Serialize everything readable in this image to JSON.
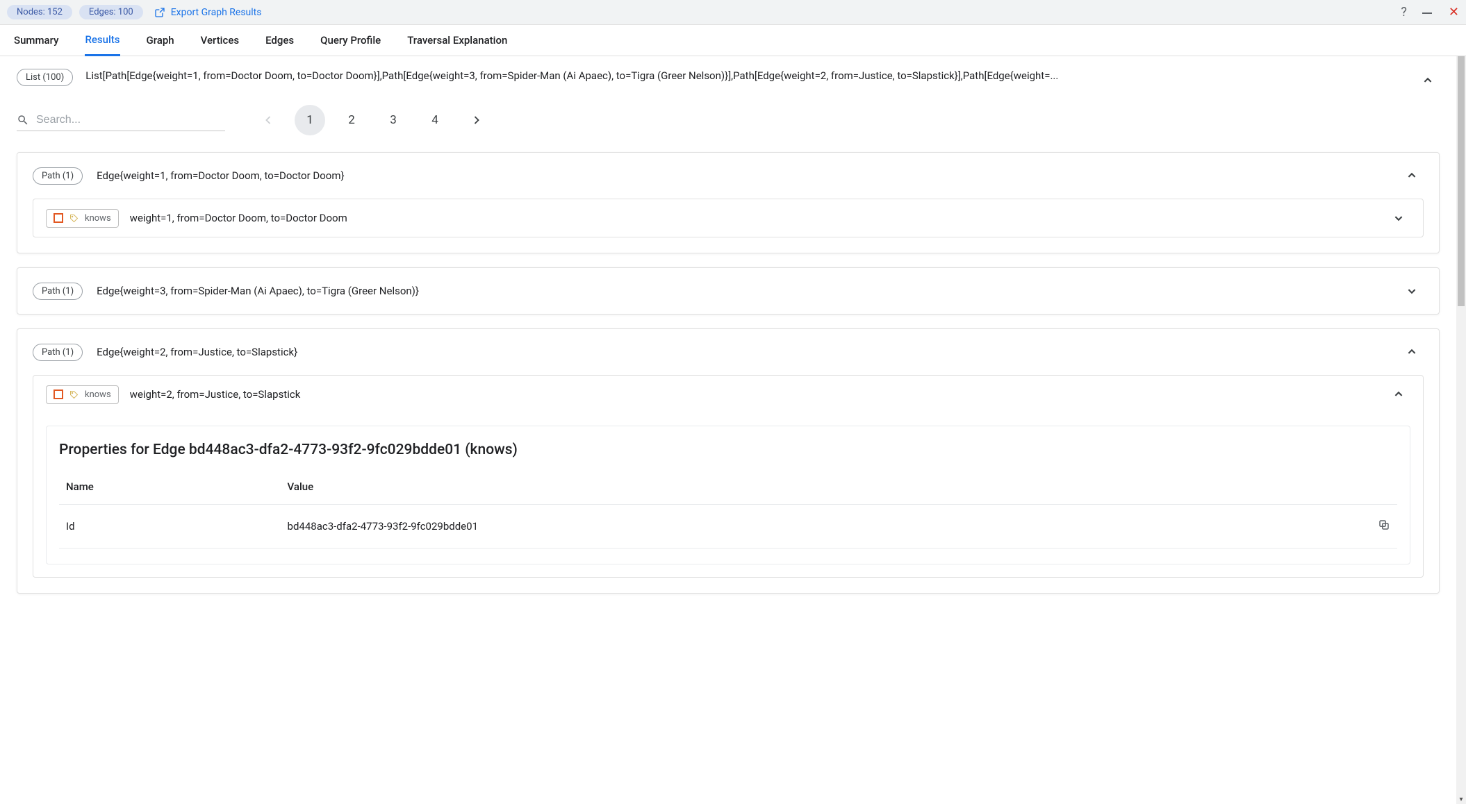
{
  "header": {
    "nodes_pill": "Nodes: 152",
    "edges_pill": "Edges: 100",
    "export_label": "Export Graph Results"
  },
  "tabs": {
    "summary": "Summary",
    "results": "Results",
    "graph": "Graph",
    "vertices": "Vertices",
    "edges": "Edges",
    "profile": "Query Profile",
    "traversal": "Traversal Explanation"
  },
  "list": {
    "chip": "List (100)",
    "text": "List[Path[Edge{weight=1, from=Doctor Doom, to=Doctor Doom}],Path[Edge{weight=3, from=Spider-Man (Ai Apaec), to=Tigra (Greer Nelson)}],Path[Edge{weight=2, from=Justice, to=Slapstick}],Path[Edge{weight=..."
  },
  "search": {
    "placeholder": "Search..."
  },
  "pager": {
    "pages": [
      "1",
      "2",
      "3",
      "4"
    ],
    "current": "1"
  },
  "paths": {
    "p1": {
      "chip": "Path (1)",
      "title": "Edge{weight=1, from=Doctor Doom, to=Doctor Doom}",
      "edge_label": "knows",
      "edge_desc": "weight=1, from=Doctor Doom, to=Doctor Doom"
    },
    "p2": {
      "chip": "Path (1)",
      "title": "Edge{weight=3, from=Spider-Man (Ai Apaec), to=Tigra (Greer Nelson)}"
    },
    "p3": {
      "chip": "Path (1)",
      "title": "Edge{weight=2, from=Justice, to=Slapstick}",
      "edge_label": "knows",
      "edge_desc": "weight=2, from=Justice, to=Slapstick",
      "props_title": "Properties for Edge bd448ac3-dfa2-4773-93f2-9fc029bdde01 (knows)",
      "cols": {
        "name": "Name",
        "value": "Value"
      },
      "rows": {
        "r1": {
          "name": "Id",
          "value": "bd448ac3-dfa2-4773-93f2-9fc029bdde01"
        }
      }
    }
  }
}
